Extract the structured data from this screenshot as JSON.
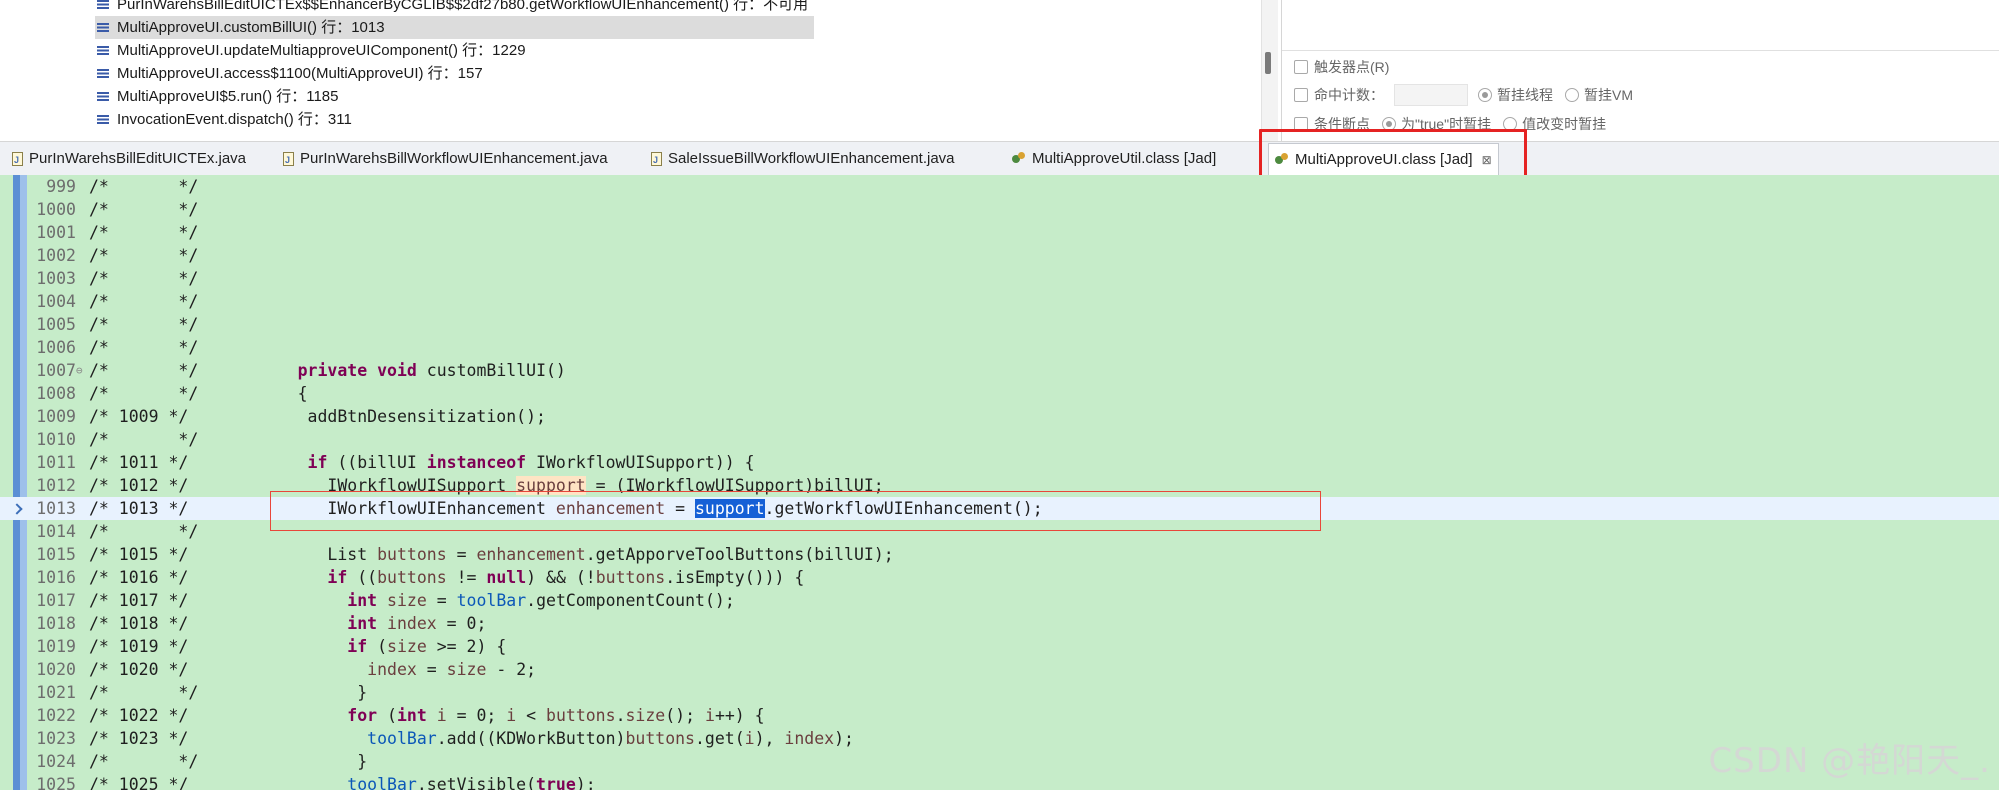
{
  "stack_frames": [
    {
      "label": "PurInWarehsBillEditUICTEx$$EnhancerByCGLIB$$2df27b80.getWorkflowUIEnhancement() 行：不可用",
      "selected": false
    },
    {
      "label": "MultiApproveUI.customBillUI() 行：1013",
      "selected": true
    },
    {
      "label": "MultiApproveUI.updateMultiapproveUIComponent() 行：1229",
      "selected": false
    },
    {
      "label": "MultiApproveUI.access$1100(MultiApproveUI) 行：157",
      "selected": false
    },
    {
      "label": "MultiApproveUI$5.run() 行：1185",
      "selected": false
    },
    {
      "label": "InvocationEvent.dispatch() 行：311",
      "selected": false
    }
  ],
  "breakpoint_props": {
    "trigger_point": "触发器点(R)",
    "hit_count": "命中计数：",
    "suspend_thread": "暂挂线程",
    "suspend_vm": "暂挂VM",
    "conditional": "条件断点",
    "when_true": "为\"true\"时暂挂",
    "when_changed": "值改变时暂挂"
  },
  "tabs": [
    {
      "label": "PurInWarehsBillEditUICTEx.java",
      "icon": "java-file-icon"
    },
    {
      "label": "PurInWarehsBillWorkflowUIEnhancement.java",
      "icon": "java-file-icon"
    },
    {
      "label": "SaleIssueBillWorkflowUIEnhancement.java",
      "icon": "java-file-icon"
    },
    {
      "label": "MultiApproveUtil.class [Jad]",
      "icon": "class-file-icon"
    },
    {
      "label": "MultiApproveUI.class [Jad]",
      "icon": "class-file-icon",
      "active": true,
      "close": "⊠"
    }
  ],
  "code": {
    "current_line": "1013",
    "lines": [
      {
        "n": "999",
        "c": "/*       */"
      },
      {
        "n": "1000",
        "c": "/*       */"
      },
      {
        "n": "1001",
        "c": "/*       */"
      },
      {
        "n": "1002",
        "c": "/*       */"
      },
      {
        "n": "1003",
        "c": "/*       */"
      },
      {
        "n": "1004",
        "c": "/*       */"
      },
      {
        "n": "1005",
        "c": "/*       */"
      },
      {
        "n": "1006",
        "c": "/*       */"
      },
      {
        "n": "1007",
        "c": "/*       */",
        "code": "private void customBillUI()"
      },
      {
        "n": "1008",
        "c": "/*       */",
        "code": "{"
      },
      {
        "n": "1009",
        "c": "/* 1009 */",
        "code": "  addBtnDesensitization();"
      },
      {
        "n": "1010",
        "c": "/*       */"
      },
      {
        "n": "1011",
        "c": "/* 1011 */",
        "code": "  if ((billUI instanceof IWorkflowUISupport)) {"
      },
      {
        "n": "1012",
        "c": "/* 1012 */",
        "code": "    IWorkflowUISupport support = (IWorkflowUISupport)billUI;"
      },
      {
        "n": "1013",
        "c": "/* 1013 */",
        "code": "    IWorkflowUIEnhancement enhancement = support.getWorkflowUIEnhancement();"
      },
      {
        "n": "1014",
        "c": "/*       */"
      },
      {
        "n": "1015",
        "c": "/* 1015 */",
        "code": "    List buttons = enhancement.getApporveToolButtons(billUI);"
      },
      {
        "n": "1016",
        "c": "/* 1016 */",
        "code": "    if ((buttons != null) && (!buttons.isEmpty())) {"
      },
      {
        "n": "1017",
        "c": "/* 1017 */",
        "code": "      int size = toolBar.getComponentCount();"
      },
      {
        "n": "1018",
        "c": "/* 1018 */",
        "code": "      int index = 0;"
      },
      {
        "n": "1019",
        "c": "/* 1019 */",
        "code": "      if (size >= 2) {"
      },
      {
        "n": "1020",
        "c": "/* 1020 */",
        "code": "        index = size - 2;"
      },
      {
        "n": "1021",
        "c": "/*       */",
        "code": "      }"
      },
      {
        "n": "1022",
        "c": "/* 1022 */",
        "code": "      for (int i = 0; i < buttons.size(); i++) {"
      },
      {
        "n": "1023",
        "c": "/* 1023 */",
        "code": "        toolBar.add((KDWorkButton)buttons.get(i), index);"
      },
      {
        "n": "1024",
        "c": "/*       */",
        "code": "      }"
      },
      {
        "n": "1025",
        "c": "/* 1025 */",
        "code": "      toolBar.setVisible(true);"
      }
    ]
  },
  "watermark": "CSDN @艳阳天_.",
  "colors": {
    "editor_bg": "#c6ecc9",
    "keyword": "#7f0055",
    "field": "#0b57b8",
    "highlight_border": "#e52323",
    "selection": "#1560d6"
  }
}
